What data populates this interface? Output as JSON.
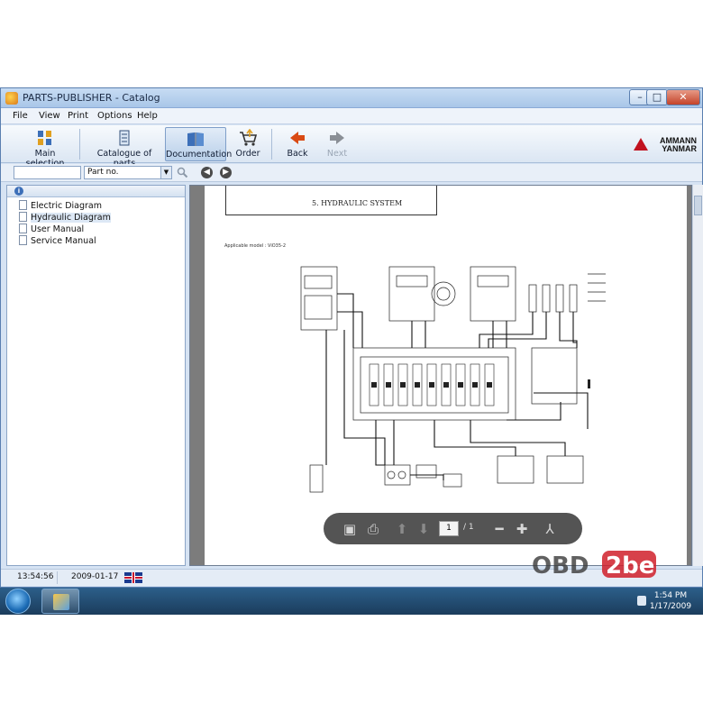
{
  "window": {
    "title": "PARTS-PUBLISHER - Catalog",
    "controls": {
      "minimize": "–",
      "maximize": "□",
      "close": "✕"
    }
  },
  "menu": [
    "File",
    "View",
    "Print",
    "Options",
    "Help"
  ],
  "toolbar": {
    "main_selection": "Main selection",
    "catalogue": "Catalogue of parts",
    "documentation": "Documentation",
    "order": "Order",
    "back": "Back",
    "next": "Next"
  },
  "brand": {
    "line1": "AMMANN",
    "line2": "YANMAR",
    "color": "#c1121f"
  },
  "search": {
    "value": "",
    "type_selected": "Part no."
  },
  "tree": {
    "items": [
      "Electric Diagram",
      "Hydraulic Diagram",
      "User Manual",
      "Service Manual"
    ],
    "selected_index": 1
  },
  "document": {
    "section_title": "5. HYDRAULIC SYSTEM",
    "applicable": "Applicable model : ViO35-2"
  },
  "pdf_toolbar": {
    "page_current": "1",
    "page_total": "/ 1"
  },
  "status": {
    "time": "13:54:56",
    "date": "2009-01-17"
  },
  "watermark": {
    "part1": "OBD",
    "part2": "2be"
  },
  "taskbar": {
    "clock_time": "1:54 PM",
    "clock_date": "1/17/2009"
  }
}
